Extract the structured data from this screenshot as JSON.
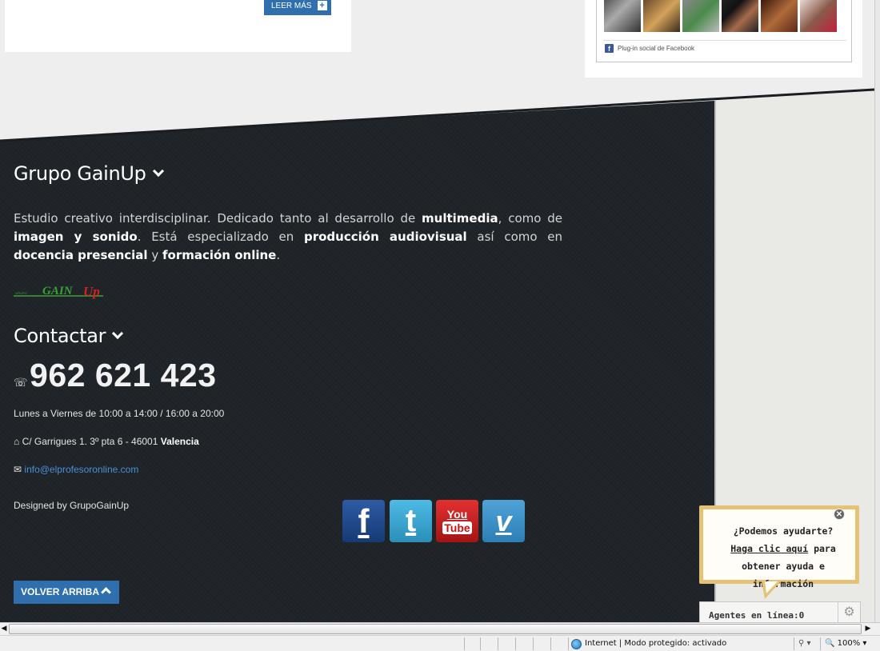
{
  "post": {
    "read_more_label": "LEER MÁS",
    "plus": "+"
  },
  "facebook": {
    "plugin_label": "Plug-in social de Facebook",
    "fb_letter": "f"
  },
  "footer": {
    "about_title": "Grupo GainUp",
    "about_text": {
      "p1": "Estudio creativo interdisciplinar. Dedicado tanto al desarrollo de ",
      "b1": "multimedia",
      "p2": ", como de ",
      "b2": "imagen y sonido",
      "p3": ". Está especializado en ",
      "b3": "producción audiovisual",
      "p4": " así como en ",
      "b4": "docencia presencial",
      "p5": " y ",
      "b5": "formación online",
      "p6": "."
    },
    "logo_text": "GAIN",
    "logo_text2": "Up",
    "logo_small": "GRUPO",
    "contact_title": "Contactar",
    "phone": "962 621 423",
    "phone_icon": "☏",
    "hours": "Lunes a Viernes de 10:00 a 14:00 / 16:00 a 20:00",
    "address_plain": "C/ Garrigues 1. 3º pta 6 - 46001 ",
    "address_city": "Valencia",
    "email": "info@elprofesoronline.com",
    "designed_by": "Designed by GrupoGainUp",
    "back_to_top": "VOLVER ARRIBA",
    "social": {
      "fb": "f",
      "tw": "t",
      "yt_top": "You",
      "yt_bottom": "Tube",
      "vi": "v"
    }
  },
  "chat": {
    "question": "¿Podemos ayudarte?",
    "link": "Haga clic aquí",
    "rest": " para obtener ayuda e información",
    "close": "✕",
    "agents": "Agentes en línea:0",
    "gear": "⚙"
  },
  "status": {
    "zone": "Internet | Modo protegido: activado",
    "zoom": "100%",
    "security": "⚲ ▾",
    "zoom_icon": "🔍",
    "arrow_left": "◀",
    "arrow_right": "▶"
  },
  "colors": {
    "accent": "#2f6fae",
    "footer_bg": "#1e2327",
    "chat_border": "#e6c276"
  }
}
